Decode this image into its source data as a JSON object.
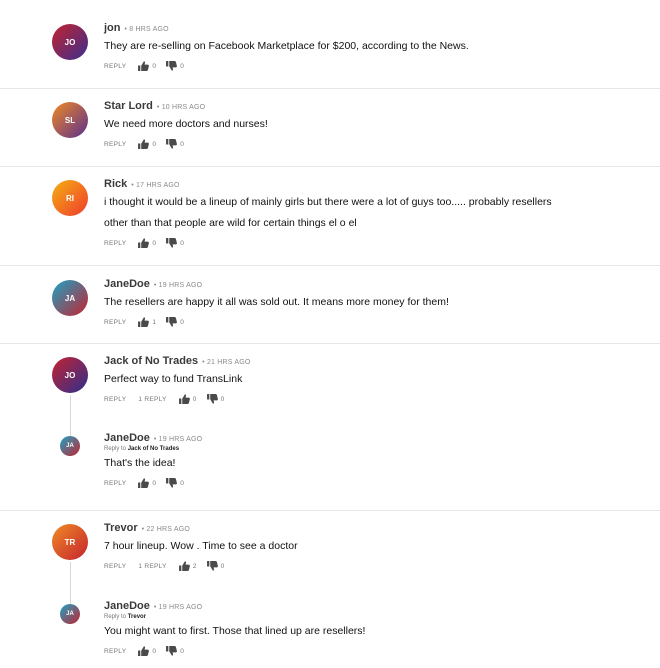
{
  "labels": {
    "reply": "REPLY",
    "reply_to_prefix": "Reply to"
  },
  "comments": [
    {
      "avatar": "JO",
      "avatar_from": "#c4232f",
      "avatar_to": "#3a2e8f",
      "name": "jon",
      "time": "• 8 HRS AGO",
      "lines": [
        "They are re-selling on Facebook Marketplace for $200, according to the News."
      ],
      "up": "0",
      "down": "0"
    },
    {
      "avatar": "SL",
      "avatar_from": "#f08a24",
      "avatar_to": "#5a2e8f",
      "name": "Star Lord",
      "time": "• 10 HRS AGO",
      "lines": [
        "We need more doctors and nurses!"
      ],
      "up": "0",
      "down": "0"
    },
    {
      "avatar": "RI",
      "avatar_from": "#f5b013",
      "avatar_to": "#ef3b2c",
      "name": "Rick",
      "time": "• 17 HRS AGO",
      "lines": [
        "i thought it would be a lineup of mainly girls but there were a lot of guys too..... probably resellers",
        "other than that people are wild for certain things el o el"
      ],
      "up": "0",
      "down": "0"
    },
    {
      "avatar": "JA",
      "avatar_from": "#1ba3c6",
      "avatar_to": "#c4232f",
      "name": "JaneDoe",
      "time": "• 19 HRS AGO",
      "lines": [
        "The resellers are happy it all was sold out. It means more money for them!"
      ],
      "up": "1",
      "down": "0"
    },
    {
      "avatar": "JO",
      "avatar_from": "#c4232f",
      "avatar_to": "#2e2e8f",
      "name": "Jack of No Trades",
      "time": "• 21 HRS AGO",
      "lines": [
        "Perfect way to fund TransLink"
      ],
      "replies": "1 REPLY",
      "up": "0",
      "down": "0",
      "child": {
        "avatar": "JA",
        "avatar_from": "#1ba3c6",
        "avatar_to": "#c4232f",
        "name": "JaneDoe",
        "time": "• 19 HRS AGO",
        "reply_to": "Jack of No Trades",
        "lines": [
          "That's the idea!"
        ],
        "up": "0",
        "down": "0"
      }
    },
    {
      "avatar": "TR",
      "avatar_from": "#f08a24",
      "avatar_to": "#c4232f",
      "name": "Trevor",
      "time": "• 22 HRS AGO",
      "lines": [
        "7 hour lineup. Wow . Time to see a doctor"
      ],
      "replies": "1 REPLY",
      "up": "2",
      "down": "0",
      "child": {
        "avatar": "JA",
        "avatar_from": "#1ba3c6",
        "avatar_to": "#c4232f",
        "name": "JaneDoe",
        "time": "• 19 HRS AGO",
        "reply_to": "Trevor",
        "lines": [
          "You might want to first. Those that lined up are resellers!"
        ],
        "up": "0",
        "down": "0"
      }
    }
  ]
}
